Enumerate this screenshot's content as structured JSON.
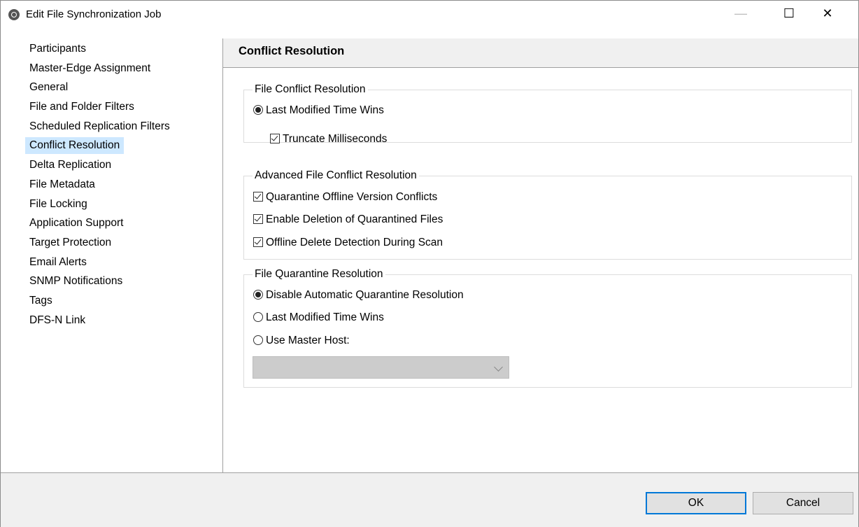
{
  "window": {
    "title": "Edit File Synchronization Job",
    "controls": {
      "minimize": "—",
      "maximize": "☐",
      "close": "✕"
    }
  },
  "nav": {
    "items": [
      {
        "label": "Participants",
        "selected": false
      },
      {
        "label": "Master-Edge Assignment",
        "selected": false
      },
      {
        "label": "General",
        "selected": false
      },
      {
        "label": "File and Folder Filters",
        "selected": false
      },
      {
        "label": "Scheduled Replication Filters",
        "selected": false
      },
      {
        "label": "Conflict Resolution",
        "selected": true
      },
      {
        "label": "Delta Replication",
        "selected": false
      },
      {
        "label": "File Metadata",
        "selected": false
      },
      {
        "label": "File Locking",
        "selected": false
      },
      {
        "label": "Application Support",
        "selected": false
      },
      {
        "label": "Target Protection",
        "selected": false
      },
      {
        "label": "Email Alerts",
        "selected": false
      },
      {
        "label": "SNMP Notifications",
        "selected": false
      },
      {
        "label": "Tags",
        "selected": false
      },
      {
        "label": "DFS-N Link",
        "selected": false
      }
    ]
  },
  "content": {
    "title": "Conflict Resolution",
    "file_conflict": {
      "label": "File Conflict Resolution",
      "last_modified": {
        "label": "Last Modified Time Wins",
        "checked": true
      },
      "truncate": {
        "label": "Truncate Milliseconds",
        "checked": true
      }
    },
    "advanced": {
      "label": "Advanced File Conflict Resolution",
      "quarantine_offline": {
        "label": "Quarantine Offline Version Conflicts",
        "checked": true
      },
      "enable_deletion": {
        "label": "Enable Deletion of Quarantined Files",
        "checked": true
      },
      "offline_delete": {
        "label": "Offline Delete Detection During Scan",
        "checked": true
      }
    },
    "quarantine": {
      "label": "File Quarantine Resolution",
      "disable_auto": {
        "label": "Disable Automatic Quarantine Resolution",
        "checked": true
      },
      "last_modified": {
        "label": "Last Modified Time Wins",
        "checked": false
      },
      "use_master": {
        "label": "Use Master Host:",
        "checked": false
      },
      "master_host_value": ""
    }
  },
  "buttons": {
    "ok": "OK",
    "cancel": "Cancel"
  },
  "colors": {
    "selection": "#cde8ff",
    "accent": "#0078d7",
    "panel": "#f0f0f0"
  }
}
